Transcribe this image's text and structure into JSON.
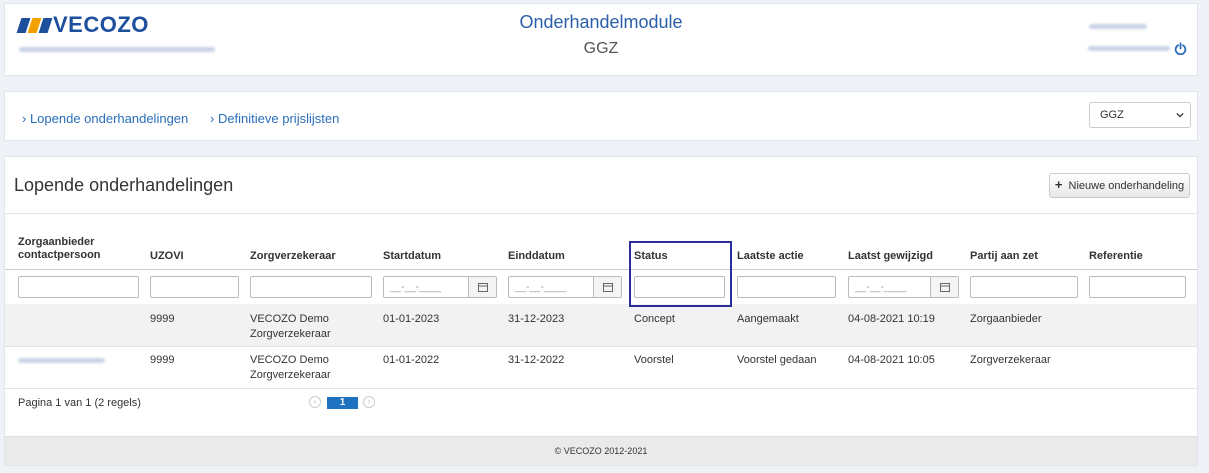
{
  "header": {
    "logo_text": "VECOZO",
    "logo_colors": [
      "#1e4f9c",
      "#f2a000",
      "#1e4f9c"
    ],
    "title": "Onderhandelmodule",
    "subtitle": "GGZ",
    "logout_icon": "power-icon"
  },
  "nav": {
    "links": [
      {
        "label": "› Lopende onderhandelingen"
      },
      {
        "label": "› Definitieve prijslijsten"
      }
    ],
    "select_value": "GGZ"
  },
  "main": {
    "heading": "Lopende onderhandelingen",
    "new_button": {
      "icon": "plus-icon",
      "label": "Nieuwe onderhandeling"
    },
    "columns": [
      "Zorgaanbieder contactpersoon",
      "UZOVI",
      "Zorgverzekeraar",
      "Startdatum",
      "Einddatum",
      "Status",
      "Laatste actie",
      "Laatst gewijzigd",
      "Partij aan zet",
      "Referentie"
    ],
    "date_placeholder": "__-__-____",
    "rows": [
      {
        "contact": "",
        "uzovi": "9999",
        "verzekeraar_1": "VECOZO Demo",
        "verzekeraar_2": "Zorgverzekeraar",
        "start": "01-01-2023",
        "eind": "31-12-2023",
        "status": "Concept",
        "laatste_actie": "Aangemaakt",
        "gewijzigd": "04-08-2021 10:19",
        "partij": "Zorgaanbieder",
        "referentie": ""
      },
      {
        "contact": "",
        "uzovi": "9999",
        "verzekeraar_1": "VECOZO Demo",
        "verzekeraar_2": "Zorgverzekeraar",
        "start": "01-01-2022",
        "eind": "31-12-2022",
        "status": "Voorstel",
        "laatste_actie": "Voorstel gedaan",
        "gewijzigd": "04-08-2021 10:05",
        "partij": "Zorgverzekeraar",
        "referentie": ""
      }
    ],
    "pager": {
      "info": "Pagina 1 van 1 (2 regels)",
      "current": "1",
      "prev": "‹",
      "next": "›"
    }
  },
  "footer": {
    "text": "© VECOZO 2012-2021"
  },
  "colors": {
    "accent": "#2a6ebb",
    "highlight": "#2b2f9e",
    "page_btn": "#1f72c0"
  }
}
